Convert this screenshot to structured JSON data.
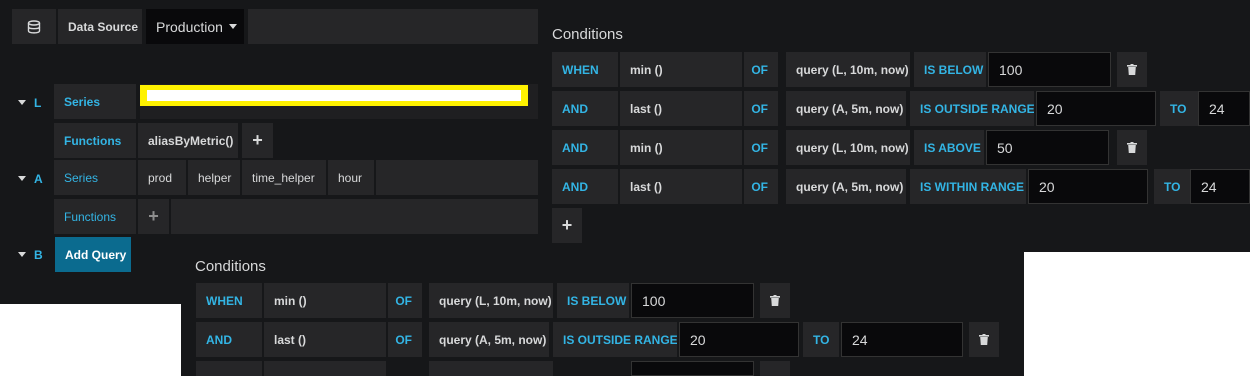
{
  "top": {
    "datasource_label": "Data Source",
    "datasource_value": "Production"
  },
  "queries": [
    {
      "letter": "L",
      "series_label": "Series",
      "functions_label": "Functions",
      "function_value": "aliasByMetric()",
      "add_label": "+"
    },
    {
      "letter": "A",
      "series_label": "Series",
      "series_segments": [
        "prod",
        "helper",
        "time_helper",
        "hour"
      ],
      "functions_label": "Functions",
      "add_label": "+"
    },
    {
      "letter": "B",
      "add_query_label": "Add Query"
    }
  ],
  "conditions_right": {
    "title": "Conditions",
    "rows": [
      {
        "kw": "WHEN",
        "fn": "min ()",
        "of": "OF",
        "query": "query (L, 10m, now)",
        "eval": "IS BELOW",
        "v1": "100"
      },
      {
        "kw": "AND",
        "fn": "last ()",
        "of": "OF",
        "query": "query (A, 5m, now)",
        "eval": "IS OUTSIDE RANGE",
        "v1": "20",
        "to": "TO",
        "v2": "24"
      },
      {
        "kw": "AND",
        "fn": "min ()",
        "of": "OF",
        "query": "query (L, 10m, now)",
        "eval": "IS ABOVE",
        "v1": "50"
      },
      {
        "kw": "AND",
        "fn": "last ()",
        "of": "OF",
        "query": "query (A, 5m, now)",
        "eval": "IS WITHIN RANGE",
        "v1": "20",
        "to": "TO",
        "v2": "24"
      }
    ],
    "add_label": "+"
  },
  "conditions_bottom": {
    "title": "Conditions",
    "rows": [
      {
        "kw": "WHEN",
        "fn": "min ()",
        "of": "OF",
        "query": "query (L, 10m, now)",
        "eval": "IS BELOW",
        "v1": "100"
      },
      {
        "kw": "AND",
        "fn": "last ()",
        "of": "OF",
        "query": "query (A, 5m, now)",
        "eval": "IS OUTSIDE RANGE",
        "v1": "20",
        "to": "TO",
        "v2": "24"
      }
    ]
  },
  "colors": {
    "panel": "#161719",
    "cell": "#262628",
    "keyword": "#33b5e5",
    "add_query": "#1f60c4",
    "highlight": "#fff200"
  }
}
